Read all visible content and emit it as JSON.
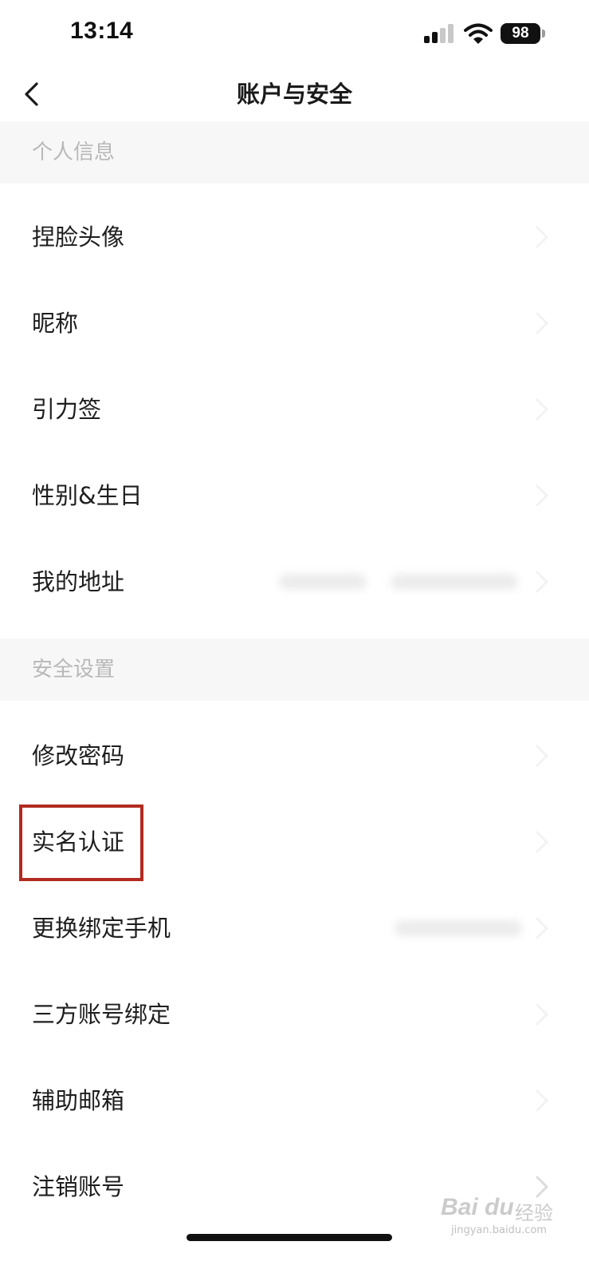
{
  "status_bar": {
    "time": "13:14",
    "battery": "98"
  },
  "nav": {
    "title": "账户与安全"
  },
  "sections": [
    {
      "header": "个人信息",
      "items": [
        {
          "label": "捏脸头像"
        },
        {
          "label": "昵称"
        },
        {
          "label": "引力签"
        },
        {
          "label": "性别&生日"
        },
        {
          "label": "我的地址"
        }
      ]
    },
    {
      "header": "安全设置",
      "items": [
        {
          "label": "修改密码"
        },
        {
          "label": "实名认证",
          "highlighted": true
        },
        {
          "label": "更换绑定手机"
        },
        {
          "label": "三方账号绑定"
        },
        {
          "label": "辅助邮箱"
        },
        {
          "label": "注销账号"
        }
      ]
    }
  ],
  "watermark": {
    "brand": "Bai du",
    "brand_cn": "经验",
    "url": "jingyan.baidu.com"
  },
  "colors": {
    "highlight": "#b22a20",
    "section_bg": "#f7f7f7",
    "section_text": "#b8b8b8"
  },
  "icons": {
    "back": "chevron-left-icon",
    "row_arrow": "chevron-right-icon",
    "signal": "signal-icon",
    "wifi": "wifi-icon",
    "battery": "battery-icon"
  }
}
